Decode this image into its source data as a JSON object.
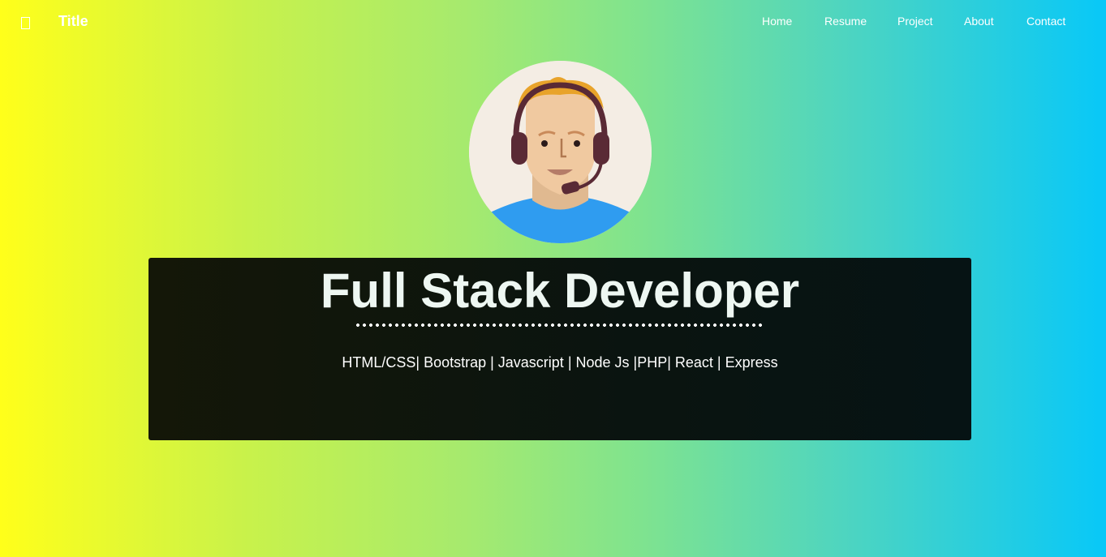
{
  "navbar": {
    "menu_icon": "menu-icon",
    "brand": "Title",
    "links": [
      {
        "label": "Home"
      },
      {
        "label": "Resume"
      },
      {
        "label": "Project"
      },
      {
        "label": "About"
      },
      {
        "label": "Contact"
      }
    ]
  },
  "avatar": {
    "icon": "developer-avatar-with-headset",
    "colors": {
      "background": "#f4ede4",
      "shirt": "#2f9cf0",
      "hair": "#e8a32a",
      "skin": "#f0c9a0",
      "headset": "#5a2a35"
    }
  },
  "hero": {
    "title": "Full Stack Developer",
    "skills": "HTML/CSS| Bootstrap | Javascript | Node Js |PHP| React | Express"
  },
  "colors": {
    "gradient_start": "#ffff1a",
    "gradient_end": "#08c8f8",
    "card_background": "#0b140e",
    "text": "#ffffff"
  }
}
